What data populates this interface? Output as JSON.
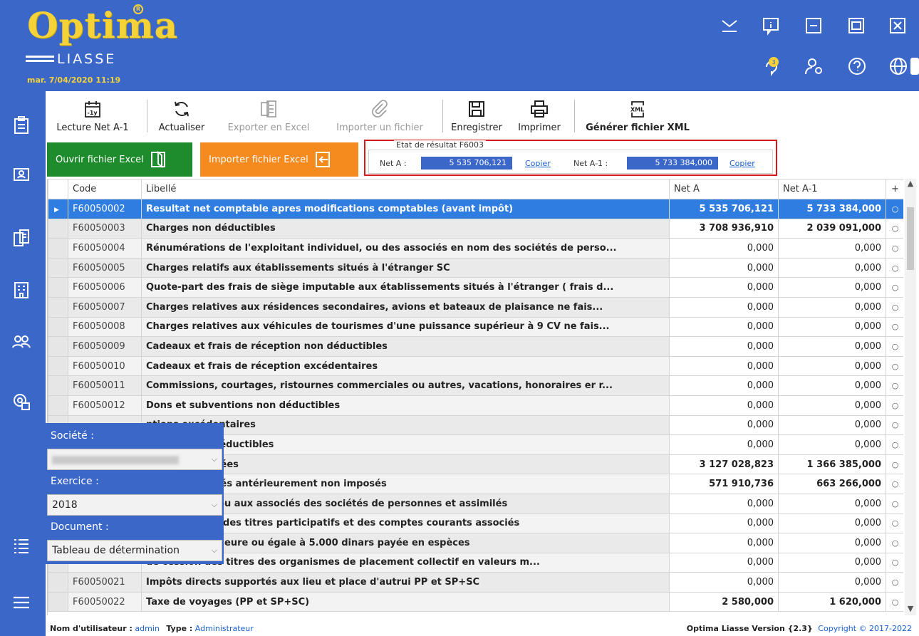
{
  "app": {
    "logo_main": "Optima",
    "logo_sub": "LIASSE",
    "datetime": "mar. 7/04/2020 11:19"
  },
  "toolbar": {
    "lecture": "Lecture Net A-1",
    "actualiser": "Actualiser",
    "exporter": "Exporter en Excel",
    "importer": "Importer un fichier",
    "enregistrer": "Enregistrer",
    "imprimer": "Imprimer",
    "generer": "Générer fichier XML"
  },
  "actions": {
    "ouvrir_excel": "Ouvrir fichier Excel",
    "importer_excel": "Importer fichier Excel"
  },
  "etat": {
    "title": "Etat de résultat F6003",
    "net_a_label": "Net A :",
    "net_a_value": "5 535 706,121",
    "net_a1_label": "Net A-1 :",
    "net_a1_value": "5 733 384,000",
    "copier": "Copier"
  },
  "table": {
    "headers": {
      "code": "Code",
      "libelle": "Libellé",
      "net_a": "Net A",
      "net_a1": "Net A-1",
      "plus": "+"
    },
    "rows": [
      {
        "code": "F60050002",
        "libelle": "Resultat net comptable apres modifications comptables (avant impôt)",
        "net_a": "5 535 706,121",
        "net_a1": "5 733 384,000",
        "bold": true
      },
      {
        "code": "F60050003",
        "libelle": "Charges non déductibles",
        "net_a": "3 708 936,910",
        "net_a1": "2 039 091,000",
        "bold": true
      },
      {
        "code": "F60050004",
        "libelle": "Rénumérations de l'exploitant individuel, ou des associés en nom des sociétés de perso...",
        "net_a": "0,000",
        "net_a1": "0,000"
      },
      {
        "code": "F60050005",
        "libelle": "Charges relatifs aux établissements situés à l'étranger SC",
        "net_a": "0,000",
        "net_a1": "0,000"
      },
      {
        "code": "F60050006",
        "libelle": "Quote-part des frais de siège imputable aux établissements situés à l'étranger ( frais d...",
        "net_a": "0,000",
        "net_a1": "0,000"
      },
      {
        "code": "F60050007",
        "libelle": "Charges relatives aux résidences secondaires, avions et bateaux de plaisance ne fais...",
        "net_a": "0,000",
        "net_a1": "0,000"
      },
      {
        "code": "F60050008",
        "libelle": "Charges relatives aux véhicules de tourismes d'une puissance supérieur à 9 CV ne fais...",
        "net_a": "0,000",
        "net_a1": "0,000"
      },
      {
        "code": "F60050009",
        "libelle": "Cadeaux et frais de réception non déductibles",
        "net_a": "0,000",
        "net_a1": "0,000"
      },
      {
        "code": "F60050010",
        "libelle": "Cadeaux et frais de réception excédentaires",
        "net_a": "0,000",
        "net_a1": "0,000"
      },
      {
        "code": "F60050011",
        "libelle": "Commissions, courtages, ristournes commerciales ou autres, vacations, honoraires er r...",
        "net_a": "0,000",
        "net_a1": "0,000"
      },
      {
        "code": "F60050012",
        "libelle": "Dons et subventions non déductibles",
        "net_a": "0,000",
        "net_a1": "0,000"
      },
      {
        "code": "",
        "libelle": "ntions excédentaires",
        "net_a": "0,000",
        "net_a1": "0,000"
      },
      {
        "code": "",
        "libelle": "réances non déductibles",
        "net_a": "0,000",
        "net_a1": "0,000"
      },
      {
        "code": "",
        "libelle": "nge non réalisées",
        "net_a": "3 127 028,823",
        "net_a1": "1 366 385,000",
        "bold": true
      },
      {
        "code": "",
        "libelle": "nge non réalisés antérieurement non imposés",
        "net_a": "571 910,736",
        "net_a1": "663 266,000",
        "bold": true
      },
      {
        "code": "",
        "libelle": "à l'exploitant ou aux associés des sociétés de personnes et assimilés",
        "net_a": "0,000",
        "net_a1": "0,000"
      },
      {
        "code": "",
        "libelle": "excédentaires des titres participatifs et des comptes courants associés",
        "net_a": "0,000",
        "net_a1": "0,000"
      },
      {
        "code": "",
        "libelle": "e valeur supérieure ou égale à 5.000 dinars payée en espèces",
        "net_a": "0,000",
        "net_a1": "0,000"
      },
      {
        "code": "",
        "libelle": "de cession des titres des organismes de placement collectif en valeurs m...",
        "net_a": "0,000",
        "net_a1": "0,000"
      },
      {
        "code": "F60050021",
        "libelle": "Impôts directs supportés aux lieu et place d'autrui PP et SP+SC",
        "net_a": "0,000",
        "net_a1": "0,000"
      },
      {
        "code": "F60050022",
        "libelle": "Taxe de voyages (PP et SP+SC)",
        "net_a": "2 580,000",
        "net_a1": "1 620,000",
        "bold": true
      }
    ]
  },
  "filters": {
    "societe_label": "Société :",
    "exercice_label": "Exercice :",
    "exercice_value": "2018",
    "document_label": "Document :",
    "document_value": "Tableau de détermination"
  },
  "footer": {
    "user_label": "Nom d'utilisateur :",
    "user_value": "admin",
    "type_label": "Type :",
    "type_value": "Administrateur",
    "version": "Optima Liasse Version {2.3}",
    "copyright": "Copyright © 2017-2022"
  },
  "colors": {
    "brand_blue": "#3b67c8",
    "logo_yellow": "#f4d238",
    "selected_row": "#2f7de1",
    "green_button": "#1e8c2c",
    "orange_button": "#f58a1f",
    "highlight_border": "#d61a1a"
  }
}
